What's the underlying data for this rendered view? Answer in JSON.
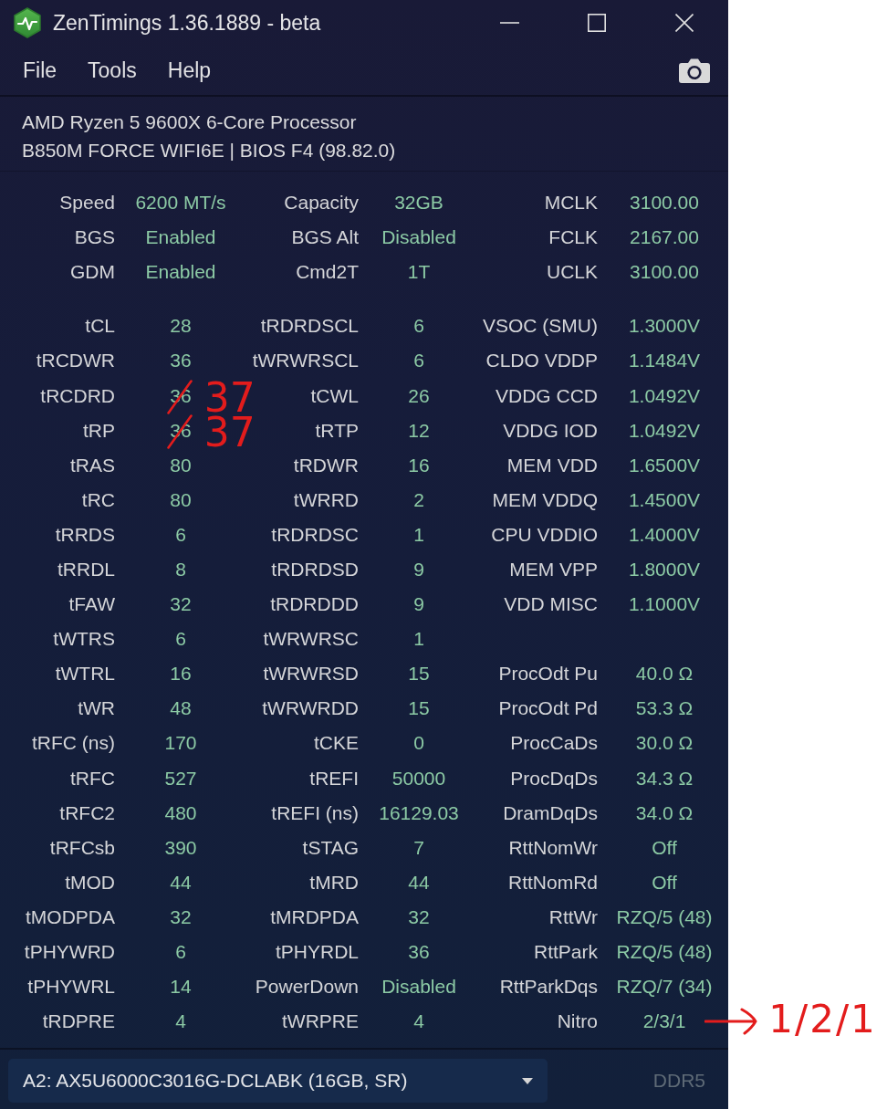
{
  "window": {
    "title": "ZenTimings 1.36.1889 - beta"
  },
  "menu": [
    "File",
    "Tools",
    "Help"
  ],
  "system": {
    "cpu": "AMD Ryzen 5 9600X 6-Core Processor",
    "board": "B850M FORCE WIFI6E | BIOS F4 (98.82.0)"
  },
  "summary": {
    "column_1": [
      {
        "label": "Speed",
        "value": "6200 MT/s"
      },
      {
        "label": "BGS",
        "value": "Enabled"
      },
      {
        "label": "GDM",
        "value": "Enabled"
      }
    ],
    "column_2": [
      {
        "label": "Capacity",
        "value": "32GB"
      },
      {
        "label": "BGS Alt",
        "value": "Disabled"
      },
      {
        "label": "Cmd2T",
        "value": "1T"
      }
    ],
    "column_3": [
      {
        "label": "MCLK",
        "value": "3100.00"
      },
      {
        "label": "FCLK",
        "value": "2167.00"
      },
      {
        "label": "UCLK",
        "value": "3100.00"
      }
    ]
  },
  "timings": {
    "column_1": [
      {
        "label": "tCL",
        "value": "28"
      },
      {
        "label": "tRCDWR",
        "value": "36"
      },
      {
        "label": "tRCDRD",
        "value": "36",
        "correction": {
          "kind": "strike",
          "text": "37"
        }
      },
      {
        "label": "tRP",
        "value": "36",
        "correction": {
          "kind": "strike",
          "text": "37"
        }
      },
      {
        "label": "tRAS",
        "value": "80"
      },
      {
        "label": "tRC",
        "value": "80"
      },
      {
        "label": "tRRDS",
        "value": "6"
      },
      {
        "label": "tRRDL",
        "value": "8"
      },
      {
        "label": "tFAW",
        "value": "32"
      },
      {
        "label": "tWTRS",
        "value": "6"
      },
      {
        "label": "tWTRL",
        "value": "16"
      },
      {
        "label": "tWR",
        "value": "48"
      },
      {
        "label": "tRFC (ns)",
        "value": "170"
      },
      {
        "label": "tRFC",
        "value": "527"
      },
      {
        "label": "tRFC2",
        "value": "480"
      },
      {
        "label": "tRFCsb",
        "value": "390"
      },
      {
        "label": "tMOD",
        "value": "44"
      },
      {
        "label": "tMODPDA",
        "value": "32"
      },
      {
        "label": "tPHYWRD",
        "value": "6"
      },
      {
        "label": "tPHYWRL",
        "value": "14"
      },
      {
        "label": "tRDPRE",
        "value": "4"
      }
    ],
    "column_2": [
      {
        "label": "tRDRDSCL",
        "value": "6"
      },
      {
        "label": "tWRWRSCL",
        "value": "6"
      },
      {
        "label": "tCWL",
        "value": "26"
      },
      {
        "label": "tRTP",
        "value": "12"
      },
      {
        "label": "tRDWR",
        "value": "16"
      },
      {
        "label": "tWRRD",
        "value": "2"
      },
      {
        "label": "tRDRDSC",
        "value": "1"
      },
      {
        "label": "tRDRDSD",
        "value": "9"
      },
      {
        "label": "tRDRDDD",
        "value": "9"
      },
      {
        "label": "tWRWRSC",
        "value": "1"
      },
      {
        "label": "tWRWRSD",
        "value": "15"
      },
      {
        "label": "tWRWRDD",
        "value": "15"
      },
      {
        "label": "tCKE",
        "value": "0"
      },
      {
        "label": "tREFI",
        "value": "50000"
      },
      {
        "label": "tREFI (ns)",
        "value": "16129.03"
      },
      {
        "label": "tSTAG",
        "value": "7"
      },
      {
        "label": "tMRD",
        "value": "44"
      },
      {
        "label": "tMRDPDA",
        "value": "32"
      },
      {
        "label": "tPHYRDL",
        "value": "36"
      },
      {
        "label": "PowerDown",
        "value": "Disabled"
      },
      {
        "label": "tWRPRE",
        "value": "4"
      }
    ]
  },
  "voltages": [
    {
      "label": "VSOC (SMU)",
      "value": "1.3000V"
    },
    {
      "label": "CLDO VDDP",
      "value": "1.1484V"
    },
    {
      "label": "VDDG CCD",
      "value": "1.0492V"
    },
    {
      "label": "VDDG IOD",
      "value": "1.0492V"
    },
    {
      "label": "MEM VDD",
      "value": "1.6500V"
    },
    {
      "label": "MEM VDDQ",
      "value": "1.4500V"
    },
    {
      "label": "CPU VDDIO",
      "value": "1.4000V"
    },
    {
      "label": "MEM VPP",
      "value": "1.8000V"
    },
    {
      "label": "VDD MISC",
      "value": "1.1000V"
    }
  ],
  "termination": [
    {
      "label": "ProcOdt Pu",
      "value": "40.0 Ω"
    },
    {
      "label": "ProcOdt Pd",
      "value": "53.3 Ω"
    },
    {
      "label": "ProcCaDs",
      "value": "30.0 Ω"
    },
    {
      "label": "ProcDqDs",
      "value": "34.3 Ω"
    },
    {
      "label": "DramDqDs",
      "value": "34.0 Ω"
    },
    {
      "label": "RttNomWr",
      "value": "Off"
    },
    {
      "label": "RttNomRd",
      "value": "Off"
    },
    {
      "label": "RttWr",
      "value": "RZQ/5 (48)"
    },
    {
      "label": "RttPark",
      "value": "RZQ/5 (48)"
    },
    {
      "label": "RttParkDqs",
      "value": "RZQ/7 (34)"
    },
    {
      "label": "Nitro",
      "value": "2/3/1",
      "correction": {
        "kind": "arrow",
        "text": "1/2/1"
      }
    }
  ],
  "module_selector": {
    "value": "A2: AX5U6000C3016G-DCLABK (16GB, SR)"
  },
  "memory_type": "DDR5"
}
